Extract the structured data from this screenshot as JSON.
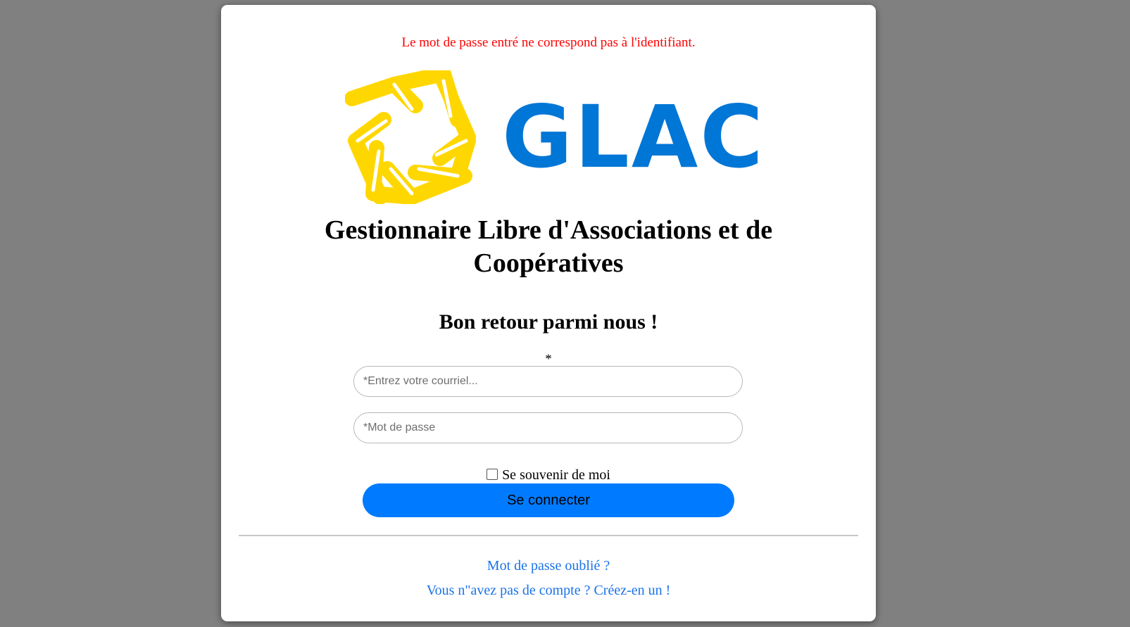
{
  "error_message": "Le mot de passe entré ne correspond pas à l'identifiant.",
  "logo": {
    "icon": "yellow-hands-heptagon-logo",
    "text": "GLAC",
    "symbol_color": "#FFD700",
    "text_color": "#0076D6"
  },
  "title_lines": [
    "Gestionnaire Libre d'Associations et de",
    "Coopératives"
  ],
  "welcome": "Bon retour parmi nous !",
  "required_marker": "*",
  "form": {
    "email_placeholder": "*Entrez votre courriel...",
    "email_value": "",
    "password_placeholder": "*Mot de passe",
    "password_value": "",
    "remember_label": "Se souvenir de moi",
    "remember_checked": false,
    "submit_label": "Se connecter",
    "submit_color": "#007BFF"
  },
  "links": {
    "forgot_password": "Mot de passe oublié ?",
    "signup": "Vous n\"avez pas de compte ? Créez-en un !",
    "link_color": "#1A73E8"
  },
  "error_color": "#FF0000"
}
